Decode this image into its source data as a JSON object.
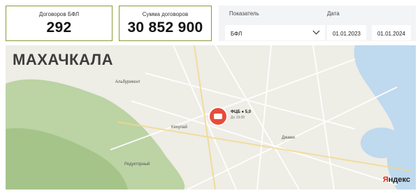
{
  "kpis": [
    {
      "label": "Договоров БФЛ",
      "value": "292"
    },
    {
      "label": "Сумма договоров",
      "value": "30 852 900"
    }
  ],
  "filters": {
    "indicator_label": "Показатель",
    "indicator_value": "БФЛ",
    "date_label": "Дата",
    "date_from": "01.01.2023",
    "date_to": "01.01.2024"
  },
  "map": {
    "city": "МАХАЧКАЛА",
    "labels": [
      "Альбурикент",
      "Кяхулай",
      "Джами",
      "Редукторный"
    ],
    "marker": {
      "title": "ФЦБ ● 5,0",
      "subtitle": "До 19:00"
    },
    "brand_1": "Я",
    "brand_2": "ндекс"
  },
  "colors": {
    "accent_border": "#8a9a33",
    "filter_bg": "#f3f4f6",
    "marker": "#e74c3c",
    "sea": "#bfd9ee",
    "hills": "#b6cf9c"
  }
}
